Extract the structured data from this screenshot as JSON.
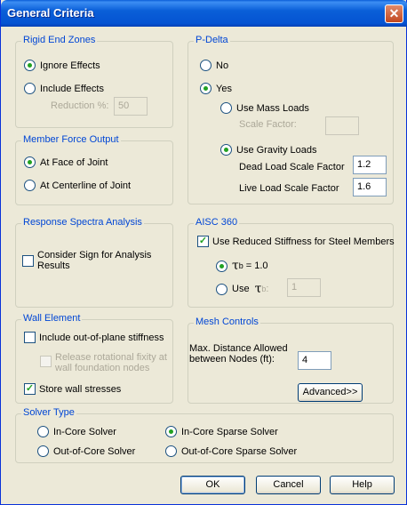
{
  "window": {
    "title": "General Criteria",
    "close_label": "✕"
  },
  "rigid_end_zones": {
    "title": "Rigid End Zones",
    "ignore": "Ignore Effects",
    "include": "Include Effects",
    "reduction_label": "Reduction %:",
    "reduction_value": "50"
  },
  "member_force": {
    "title": "Member Force Output",
    "face": "At Face of Joint",
    "centerline": "At Centerline of Joint"
  },
  "response_spectra": {
    "title": "Response Spectra Analysis",
    "consider_sign": "Consider Sign for Analysis Results"
  },
  "wall_element": {
    "title": "Wall Element",
    "out_of_plane": "Include out-of-plane stiffness",
    "release_fixity": "Release rotational fixity at wall foundation nodes",
    "store_stresses": "Store wall stresses",
    "store_check": "✓"
  },
  "p_delta": {
    "title": "P-Delta",
    "no": "No",
    "yes": "Yes",
    "mass_loads": "Use Mass Loads",
    "scale_factor_label": "Scale Factor:",
    "scale_factor_value": "",
    "gravity_loads": "Use Gravity Loads",
    "dead_label": "Dead Load Scale Factor",
    "dead_value": "1.2",
    "live_label": "Live Load Scale Factor",
    "live_value": "1.6"
  },
  "aisc": {
    "title": "AISC 360",
    "reduced_stiffness": "Use Reduced Stiffness for Steel Members",
    "reduced_check": "✓",
    "tau_symbol": "τ",
    "tau_sub": "b",
    "tau_eq": "= 1.0",
    "use_label": "Use",
    "tau_suffix": ":",
    "tau_value": "1"
  },
  "mesh": {
    "title": "Mesh Controls",
    "max_distance": "Max. Distance Allowed between Nodes (ft):",
    "max_value": "4",
    "advanced": "Advanced>>"
  },
  "solver": {
    "title": "Solver Type",
    "in_core": "In-Core Solver",
    "in_core_sparse": "In-Core Sparse Solver",
    "out_core": "Out-of-Core Solver",
    "out_core_sparse": "Out-of-Core Sparse Solver"
  },
  "buttons": {
    "ok": "OK",
    "cancel": "Cancel",
    "help": "Help"
  }
}
